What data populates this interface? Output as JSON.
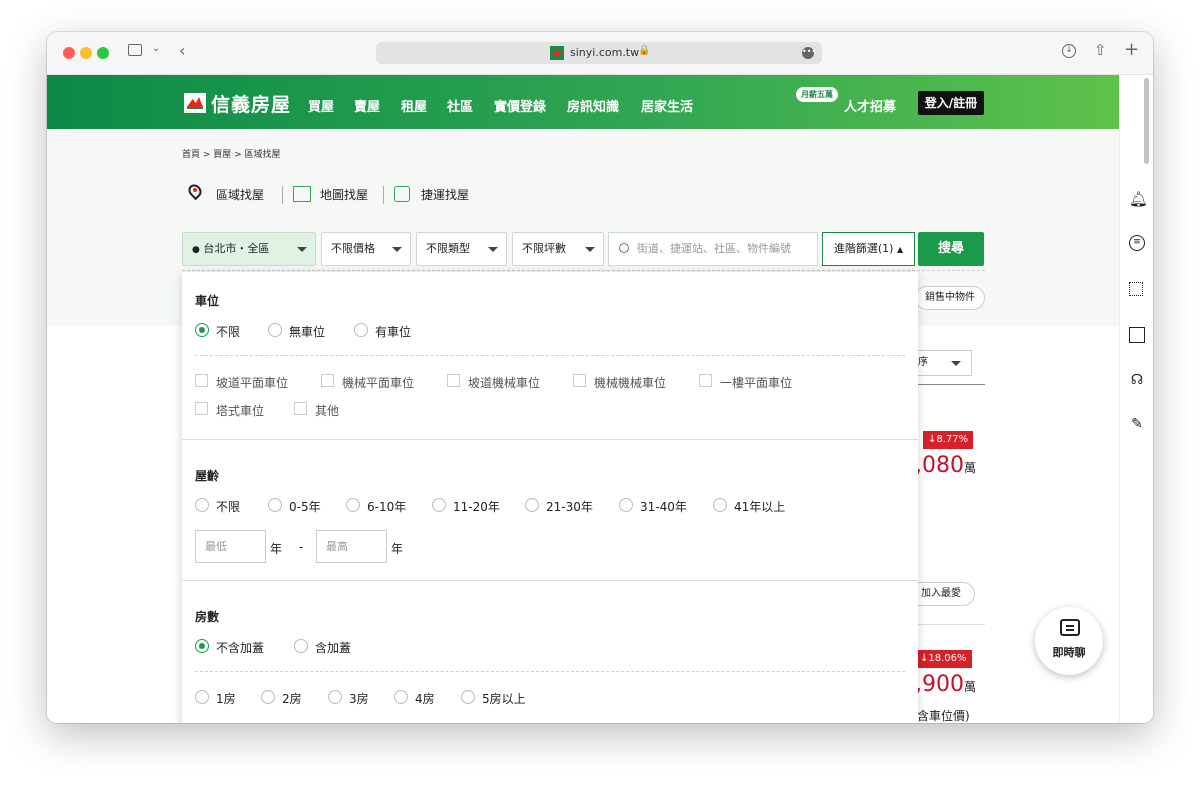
{
  "browser": {
    "url": "sinyi.com.tw"
  },
  "header": {
    "logo_text": "信義房屋",
    "nav": [
      "買屋",
      "賣屋",
      "租屋",
      "社區",
      "實價登錄",
      "房訊知識",
      "居家生活"
    ],
    "bubble": "月薪五萬",
    "careers": "人才招募",
    "login": "登入/註冊"
  },
  "breadcrumb": "首頁  >  買屋  >  區域找屋",
  "tabs": [
    "區域找屋",
    "地圖找屋",
    "捷運找屋"
  ],
  "filters": {
    "region": "台北市・全區",
    "price": "不限價格",
    "type": "不限類型",
    "size": "不限坪數",
    "search_placeholder": "街道、捷運站、社區、物件編號",
    "advanced": "進階篩選(1)",
    "search_button": "搜尋"
  },
  "background": {
    "chip": "銷售中物件",
    "sort": "序",
    "listings": [
      {
        "discount": "↓8.77%",
        "price": ",080",
        "unit": "萬"
      },
      {
        "discount": "↓18.06%",
        "price": ",900",
        "unit": "萬",
        "note": "含車位價)"
      }
    ],
    "fav": "加入最愛"
  },
  "panel": {
    "parking": {
      "title": "車位",
      "options": [
        "不限",
        "無車位",
        "有車位"
      ],
      "selected": "不限",
      "types": [
        "坡道平面車位",
        "機械平面車位",
        "坡道機械車位",
        "機械機械車位",
        "一樓平面車位",
        "塔式車位",
        "其他"
      ]
    },
    "age": {
      "title": "屋齡",
      "options": [
        "不限",
        "0-5年",
        "6-10年",
        "11-20年",
        "21-30年",
        "31-40年",
        "41年以上"
      ],
      "min_placeholder": "最低",
      "max_placeholder": "最高",
      "unit": "年",
      "dash": "-"
    },
    "rooms": {
      "title": "房數",
      "options": [
        "不含加蓋",
        "含加蓋"
      ],
      "selected": "不含加蓋",
      "counts": [
        "1房",
        "2房",
        "3房",
        "4房",
        "5房以上"
      ]
    }
  },
  "chat": {
    "label": "即時聊"
  },
  "colors": {
    "brand_green": "#1a9b4b",
    "accent_red": "#d6202a"
  }
}
